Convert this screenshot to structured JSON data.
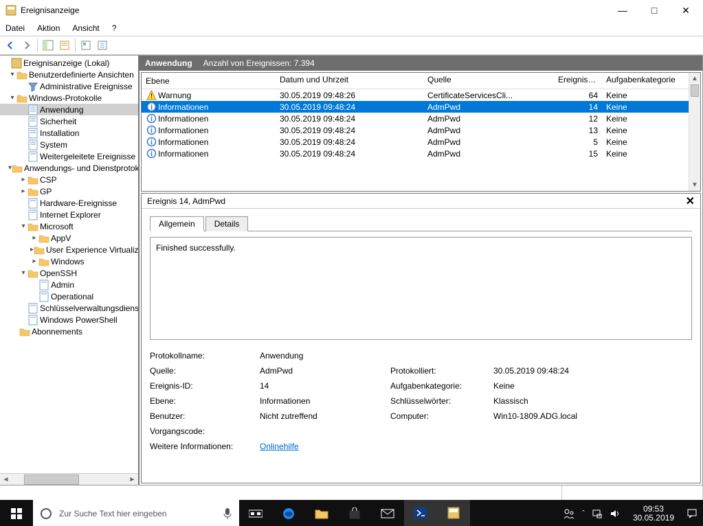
{
  "window": {
    "title": "Ereignisanzeige"
  },
  "menu": {
    "file": "Datei",
    "action": "Aktion",
    "view": "Ansicht",
    "help": "?"
  },
  "tree": {
    "root": "Ereignisanzeige (Lokal)",
    "custom_views": "Benutzerdefinierte Ansichten",
    "admin_events": "Administrative Ereignisse",
    "win_protocols": "Windows-Protokolle",
    "application": "Anwendung",
    "security": "Sicherheit",
    "installation": "Installation",
    "system": "System",
    "forwarded": "Weitergeleitete Ereignisse",
    "app_service": "Anwendungs- und Dienstprotokolle",
    "csp": "CSP",
    "gp": "GP",
    "hardware": "Hardware-Ereignisse",
    "ie": "Internet Explorer",
    "microsoft": "Microsoft",
    "appv": "AppV",
    "uev": "User Experience Virtualization",
    "windows": "Windows",
    "openssh": "OpenSSH",
    "admin": "Admin",
    "operational": "Operational",
    "keymgmt": "Schlüsselverwaltungsdienst",
    "powershell": "Windows PowerShell",
    "subs": "Abonnements"
  },
  "list": {
    "header_title": "Anwendung",
    "header_sub": "Anzahl von Ereignissen: 7.394",
    "cols": {
      "level": "Ebene",
      "date": "Datum und Uhrzeit",
      "source": "Quelle",
      "id": "Ereignis-ID",
      "cat": "Aufgabenkategorie"
    },
    "rows": [
      {
        "icon": "warn",
        "level": "Warnung",
        "date": "30.05.2019 09:48:26",
        "source": "CertificateServicesCli...",
        "id": "64",
        "cat": "Keine",
        "sel": false
      },
      {
        "icon": "info",
        "level": "Informationen",
        "date": "30.05.2019 09:48:24",
        "source": "AdmPwd",
        "id": "14",
        "cat": "Keine",
        "sel": true
      },
      {
        "icon": "info",
        "level": "Informationen",
        "date": "30.05.2019 09:48:24",
        "source": "AdmPwd",
        "id": "12",
        "cat": "Keine",
        "sel": false
      },
      {
        "icon": "info",
        "level": "Informationen",
        "date": "30.05.2019 09:48:24",
        "source": "AdmPwd",
        "id": "13",
        "cat": "Keine",
        "sel": false
      },
      {
        "icon": "info",
        "level": "Informationen",
        "date": "30.05.2019 09:48:24",
        "source": "AdmPwd",
        "id": "5",
        "cat": "Keine",
        "sel": false
      },
      {
        "icon": "info",
        "level": "Informationen",
        "date": "30.05.2019 09:48:24",
        "source": "AdmPwd",
        "id": "15",
        "cat": "Keine",
        "sel": false
      }
    ]
  },
  "detail": {
    "title": "Ereignis 14, AdmPwd",
    "tabs": {
      "general": "Allgemein",
      "details": "Details"
    },
    "message": "Finished successfully.",
    "labels": {
      "logname": "Protokollname:",
      "source": "Quelle:",
      "eventid": "Ereignis-ID:",
      "level": "Ebene:",
      "user": "Benutzer:",
      "opcode": "Vorgangscode:",
      "more": "Weitere Informationen:",
      "logged": "Protokolliert:",
      "cat": "Aufgabenkategorie:",
      "keywords": "Schlüsselwörter:",
      "computer": "Computer:"
    },
    "values": {
      "logname": "Anwendung",
      "source": "AdmPwd",
      "eventid": "14",
      "level": "Informationen",
      "user": "Nicht zutreffend",
      "opcode": "",
      "more": "Onlinehilfe",
      "logged": "30.05.2019 09:48:24",
      "cat": "Keine",
      "keywords": "Klassisch",
      "computer": "Win10-1809.ADG.local"
    }
  },
  "taskbar": {
    "search_placeholder": "Zur Suche Text hier eingeben",
    "time": "09:53",
    "date": "30.05.2019"
  }
}
